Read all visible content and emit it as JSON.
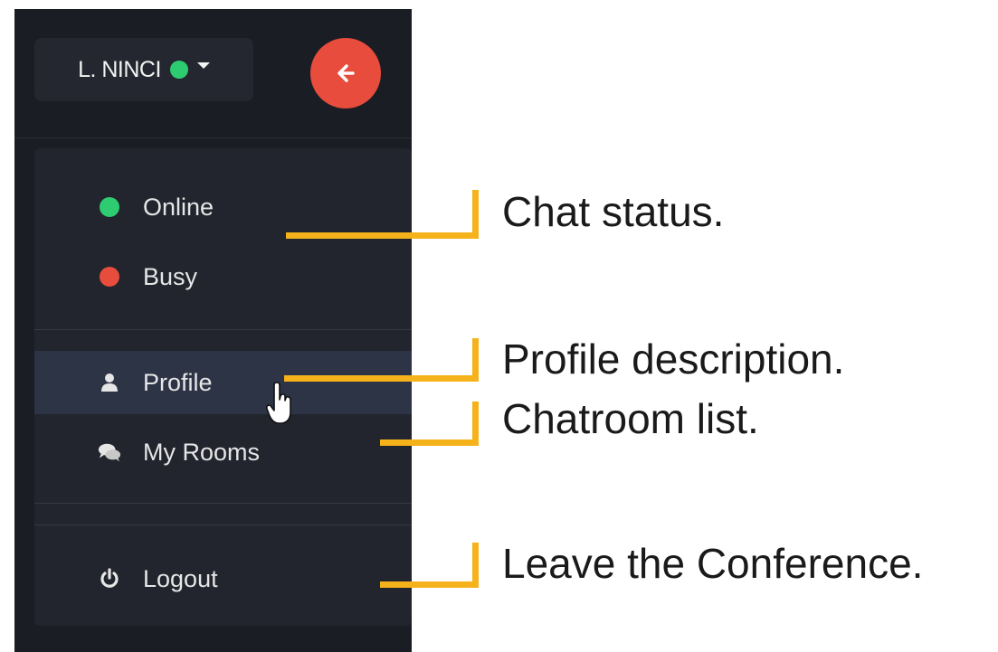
{
  "user": {
    "name": "L. NINCI",
    "status_color": "#2ecc71"
  },
  "back_button": {
    "icon": "arrow-left-icon",
    "color": "#e74c3c"
  },
  "menu": {
    "status_items": [
      {
        "label": "Online",
        "color": "#2ecc71"
      },
      {
        "label": "Busy",
        "color": "#e74c3c"
      }
    ],
    "profile_label": "Profile",
    "rooms_label": "My Rooms",
    "logout_label": "Logout",
    "hovered": "Profile"
  },
  "callouts": {
    "chat_status": "Chat status.",
    "profile": "Profile description.",
    "rooms": "Chatroom list.",
    "logout": "Leave the Conference.",
    "accent": "#f5b21b"
  }
}
